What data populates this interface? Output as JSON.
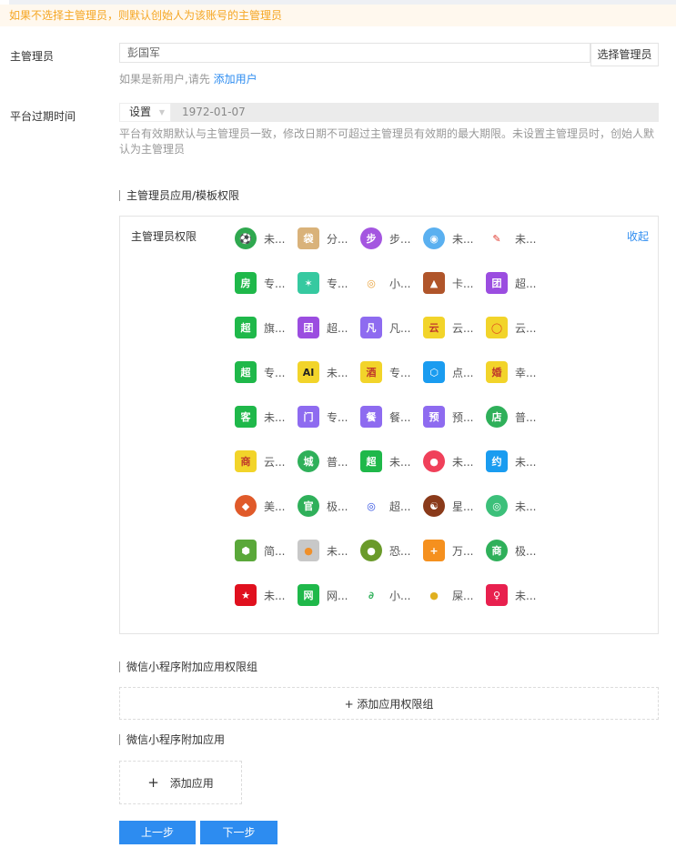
{
  "warning": "如果不选择主管理员，则默认创始人为该账号的主管理员",
  "admin": {
    "label": "主管理员",
    "value": "彭国军",
    "select_button": "选择管理员",
    "hint_prefix": "如果是新用户,请先 ",
    "hint_link": "添加用户"
  },
  "expiry": {
    "label": "平台过期时间",
    "select": "设置",
    "date": "1972-01-07",
    "hint": "平台有效期默认与主管理员一致，修改日期不可超过主管理员有效期的最大期限。未设置主管理员时，创始人默认为主管理员"
  },
  "section1": "主管理员应用/模板权限",
  "permissions": {
    "title": "主管理员权限",
    "collapse": "收起",
    "apps": [
      {
        "label": "未...",
        "color": "#2fa84f",
        "char": "⚽",
        "round": true
      },
      {
        "label": "分...",
        "color": "#d9b27a",
        "char": "袋"
      },
      {
        "label": "步...",
        "color": "#a456e0",
        "char": "步",
        "round": true
      },
      {
        "label": "未...",
        "color": "#5ab0f0",
        "char": "◉",
        "round": true
      },
      {
        "label": "未...",
        "color": "#ffffff",
        "char": "✎",
        "fg": "#e03a2f"
      },
      {
        "label": "专...",
        "color": "#1fb84a",
        "char": "房"
      },
      {
        "label": "专...",
        "color": "#36c9a0",
        "char": "✶"
      },
      {
        "label": "小...",
        "color": "#ffffff",
        "char": "◎",
        "fg": "#e9a23b",
        "round": true
      },
      {
        "label": "卡...",
        "color": "#b0552a",
        "char": "▲"
      },
      {
        "label": "超...",
        "color": "#9b4de0",
        "char": "团"
      },
      {
        "label": "旗...",
        "color": "#1fb84a",
        "char": "超"
      },
      {
        "label": "超...",
        "color": "#9b4de0",
        "char": "团"
      },
      {
        "label": "凡...",
        "color": "#8e6bf0",
        "char": "凡"
      },
      {
        "label": "云...",
        "color": "#f2d42a",
        "char": "云",
        "fg": "#c0392b"
      },
      {
        "label": "云...",
        "color": "#f2d42a",
        "char": "◯",
        "fg": "#e0501e"
      },
      {
        "label": "专...",
        "color": "#1fb84a",
        "char": "超"
      },
      {
        "label": "未...",
        "color": "#f2d42a",
        "char": "AI",
        "fg": "#222"
      },
      {
        "label": "专...",
        "color": "#f2d42a",
        "char": "酒",
        "fg": "#c0392b"
      },
      {
        "label": "点...",
        "color": "#1a9cf0",
        "char": "⬡"
      },
      {
        "label": "幸...",
        "color": "#f2d42a",
        "char": "婚",
        "fg": "#c0392b"
      },
      {
        "label": "未...",
        "color": "#1fb84a",
        "char": "客"
      },
      {
        "label": "专...",
        "color": "#8e6bf0",
        "char": "门"
      },
      {
        "label": "餐...",
        "color": "#8e6bf0",
        "char": "餐"
      },
      {
        "label": "预...",
        "color": "#8e6bf0",
        "char": "预"
      },
      {
        "label": "普...",
        "color": "#2fb05a",
        "char": "店",
        "round": true
      },
      {
        "label": "云...",
        "color": "#f2d42a",
        "char": "商",
        "fg": "#c0392b"
      },
      {
        "label": "普...",
        "color": "#2fb05a",
        "char": "城",
        "round": true
      },
      {
        "label": "未...",
        "color": "#1fb84a",
        "char": "超"
      },
      {
        "label": "未...",
        "color": "#f0405a",
        "char": "●",
        "round": true
      },
      {
        "label": "未...",
        "color": "#1a9cf0",
        "char": "约"
      },
      {
        "label": "美...",
        "color": "#e05a2a",
        "char": "◆",
        "round": true
      },
      {
        "label": "极...",
        "color": "#2fb05a",
        "char": "官",
        "round": true
      },
      {
        "label": "超...",
        "color": "#ffffff",
        "char": "◎",
        "fg": "#2a4ae0",
        "round": true
      },
      {
        "label": "星...",
        "color": "#8a3a1a",
        "char": "☯",
        "round": true
      },
      {
        "label": "未...",
        "color": "#3cc07a",
        "char": "◎",
        "round": true
      },
      {
        "label": "简...",
        "color": "#5aa83a",
        "char": "⬢"
      },
      {
        "label": "未...",
        "color": "#c8c8c8",
        "char": "●",
        "fg": "#f0902a"
      },
      {
        "label": "恐...",
        "color": "#6a9a2a",
        "char": "●",
        "round": true
      },
      {
        "label": "万...",
        "color": "#f5901e",
        "char": "+"
      },
      {
        "label": "极...",
        "color": "#2fb05a",
        "char": "商",
        "round": true
      },
      {
        "label": "未...",
        "color": "#e0101e",
        "char": "★"
      },
      {
        "label": "网...",
        "color": "#1fb84a",
        "char": "网"
      },
      {
        "label": "小...",
        "color": "#ffffff",
        "char": "∂",
        "fg": "#2fb05a",
        "round": true
      },
      {
        "label": "屎...",
        "color": "#ffffff",
        "char": "●",
        "fg": "#e0b020"
      },
      {
        "label": "未...",
        "color": "#e8204e",
        "char": "♀"
      }
    ]
  },
  "section2": "微信小程序附加应用权限组",
  "add_group": "+ 添加应用权限组",
  "section3": "微信小程序附加应用",
  "add_app_plus": "+",
  "add_app": "添加应用",
  "prev": "上一步",
  "next": "下一步"
}
